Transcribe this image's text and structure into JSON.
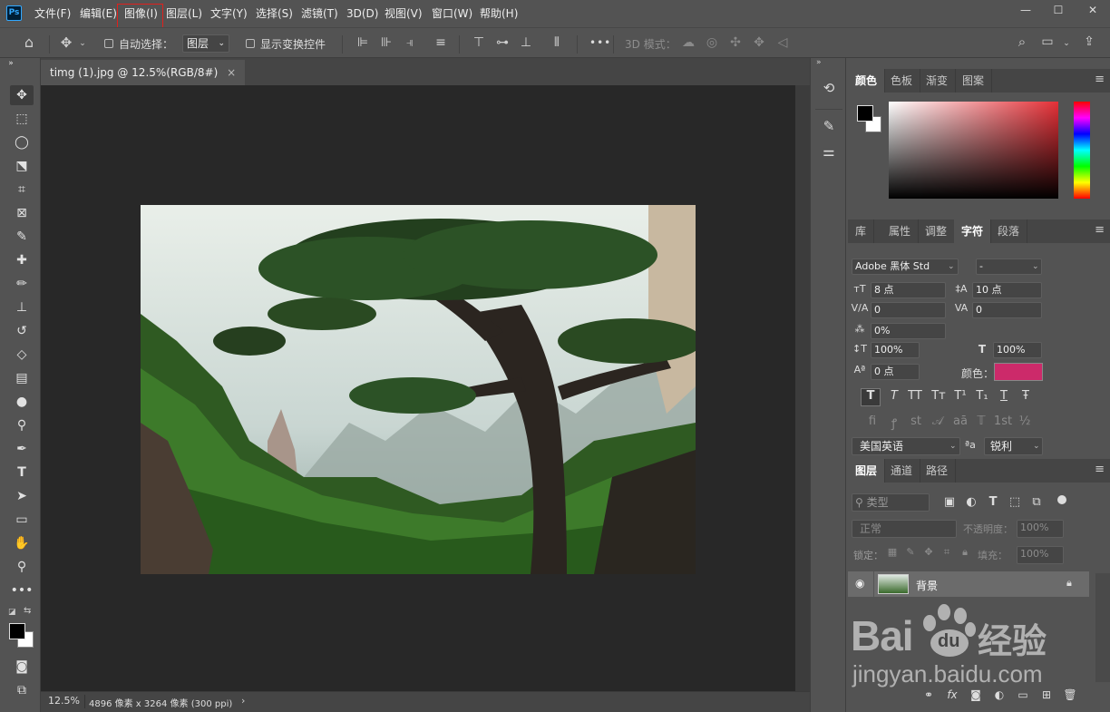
{
  "menu": {
    "logo": "Ps",
    "items": [
      "文件(F)",
      "编辑(E)",
      "图像(I)",
      "图层(L)",
      "文字(Y)",
      "选择(S)",
      "滤镜(T)",
      "3D(D)",
      "视图(V)",
      "窗口(W)",
      "帮助(H)"
    ]
  },
  "window_controls": {
    "minimize": "—",
    "maximize": "☐",
    "close": "✕"
  },
  "options": {
    "auto_select_label": "自动选择：",
    "auto_select_value": "图层",
    "show_transform_label": "显示变换控件",
    "more": "•••",
    "mode_3d_label": "3D 模式："
  },
  "document": {
    "tab_title": "timg (1).jpg @ 12.5%(RGB/8#)",
    "tab_close": "×",
    "zoom": "12.5%",
    "size_info": "4896 像素 x 3264 像素 (300 ppi)",
    "status_arrow": "›"
  },
  "color_panel": {
    "tabs": [
      "颜色",
      "色板",
      "渐变",
      "图案"
    ],
    "active": 0,
    "foreground": "#000000",
    "background": "#ffffff",
    "hue_base": "#e53037"
  },
  "char_panel": {
    "tabs": [
      "库",
      "属性",
      "调整",
      "字符",
      "段落"
    ],
    "active": 3,
    "font_family": "Adobe 黑体 Std",
    "font_style": "-",
    "font_size": "8 点",
    "leading": "10 点",
    "kerning": "0",
    "tracking": "0",
    "tsume": "0%",
    "vscale": "100%",
    "hscale": "100%",
    "baseline": "0 点",
    "color_label": "颜色：",
    "color_value": "#cc2a6a",
    "language": "美国英语",
    "aa_label": "ªa",
    "antialias": "锐利",
    "style_buttons": [
      "T",
      "T",
      "TT",
      "Tт",
      "T¹",
      "T₁",
      "T",
      "Ŧ"
    ],
    "opentype_buttons": [
      "fi",
      "ꝭ",
      "st",
      "𝒜",
      "aā",
      "𝕋",
      "1st",
      "½"
    ]
  },
  "layers_panel": {
    "tabs": [
      "图层",
      "通道",
      "路径"
    ],
    "active": 0,
    "filter_label": "类型",
    "blend_mode": "正常",
    "opacity_label": "不透明度：",
    "opacity_value": "100%",
    "lock_label": "锁定：",
    "fill_label": "填充：",
    "fill_value": "100%",
    "layer_name": "背景"
  },
  "watermark": {
    "brand_latin_1": "Bai",
    "brand_latin_2": "du",
    "brand_cn": "经验",
    "url": "jingyan.baidu.com"
  }
}
